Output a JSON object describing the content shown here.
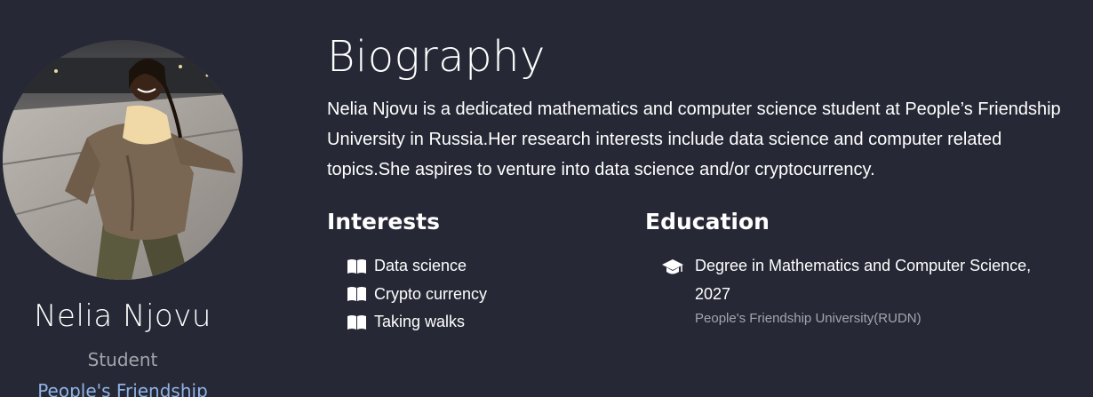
{
  "profile": {
    "name": "Nelia Njovu",
    "role": "Student",
    "affiliation": "People's Friendship"
  },
  "biography": {
    "title": "Biography",
    "text": "Nelia Njovu is a dedicated mathematics and computer science student at People’s Friendship University in Russia.Her research interests include data science and computer related topics.She aspires to venture into data science and/or cryptocurrency."
  },
  "interests": {
    "title": "Interests",
    "icon": "book-open-icon",
    "items": [
      {
        "label": "Data science"
      },
      {
        "label": "Crypto currency"
      },
      {
        "label": "Taking walks"
      }
    ]
  },
  "education": {
    "title": "Education",
    "icon": "graduation-cap-icon",
    "items": [
      {
        "degree": "Degree in Mathematics and Computer Science, 2027",
        "institution": "People's Friendship University(RUDN)"
      }
    ]
  },
  "colors": {
    "background": "#262835",
    "text": "#ffffff",
    "muted": "#a3a5ad",
    "link": "#8fb3e6"
  }
}
